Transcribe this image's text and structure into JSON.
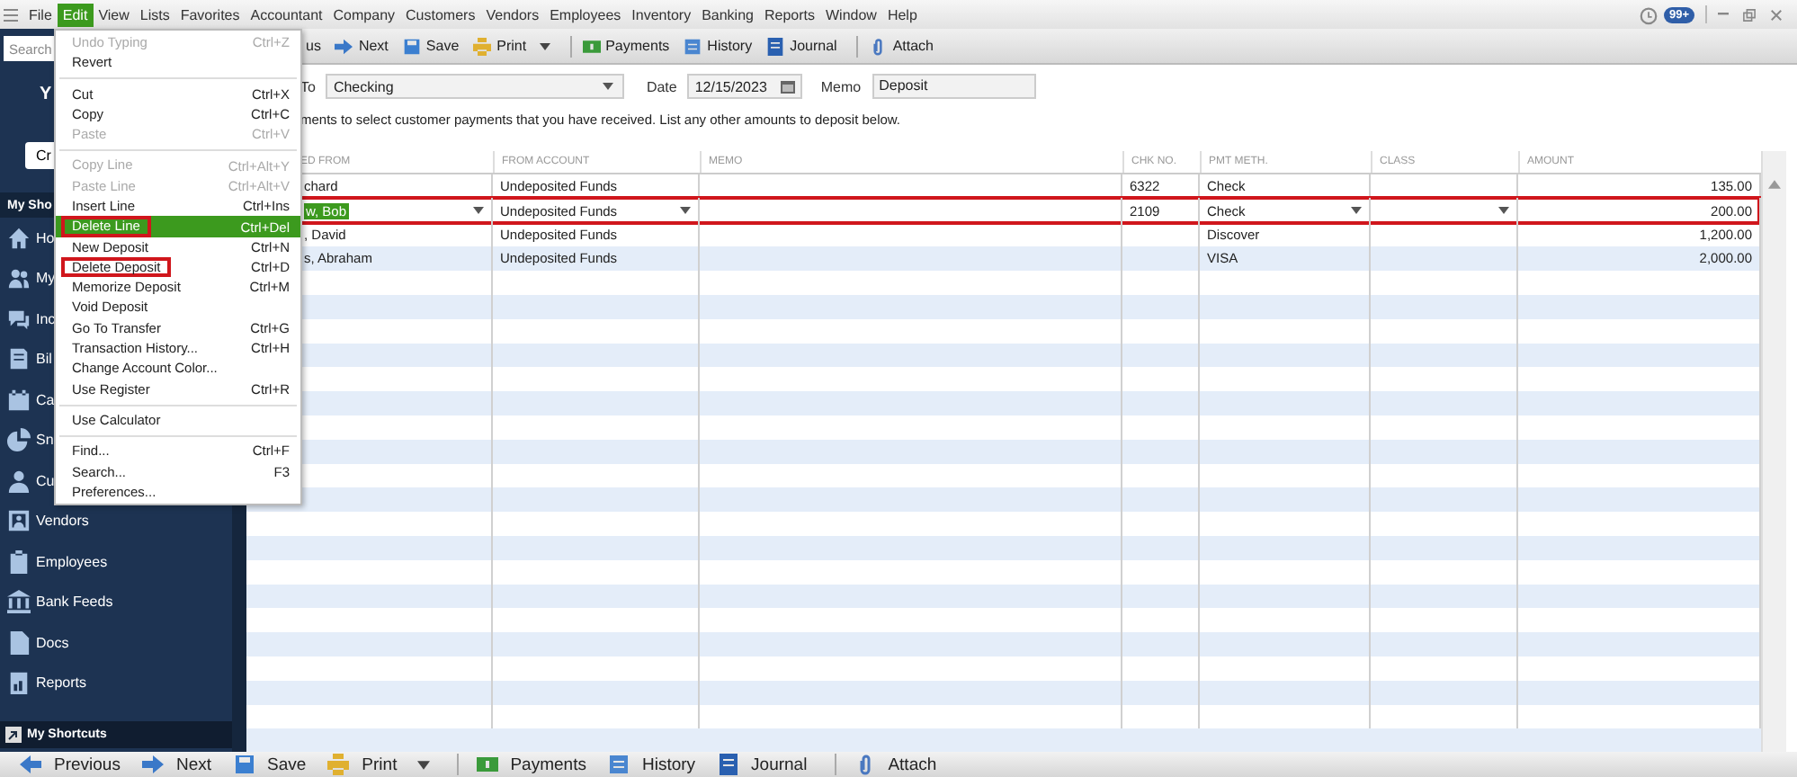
{
  "menu_bar": [
    {
      "label": "File",
      "selected": false
    },
    {
      "label": "Edit",
      "selected": true
    },
    {
      "label": "View",
      "selected": false
    },
    {
      "label": "Lists",
      "selected": false
    },
    {
      "label": "Favorites",
      "selected": false
    },
    {
      "label": "Accountant",
      "selected": false
    },
    {
      "label": "Company",
      "selected": false
    },
    {
      "label": "Customers",
      "selected": false
    },
    {
      "label": "Vendors",
      "selected": false
    },
    {
      "label": "Employees",
      "selected": false
    },
    {
      "label": "Inventory",
      "selected": false
    },
    {
      "label": "Banking",
      "selected": false
    },
    {
      "label": "Reports",
      "selected": false
    },
    {
      "label": "Window",
      "selected": false
    },
    {
      "label": "Help",
      "selected": false
    }
  ],
  "notification_badge": "99+",
  "sidebar": {
    "search_placeholder": "Search",
    "company_label": "Y",
    "create_button": "Cr",
    "section_title": "My Sho",
    "items": [
      "Ho",
      "My",
      "Inc",
      "Bil",
      "Ca",
      "Sn",
      "Cu",
      "Vendors",
      "Employees",
      "Bank Feeds",
      "Docs",
      "Reports"
    ],
    "footer": "My Shortcuts"
  },
  "toolbar": [
    {
      "label": "us",
      "dropdown": false,
      "separator_before": false
    },
    {
      "label": "Next",
      "dropdown": false,
      "separator_before": false
    },
    {
      "label": "Save",
      "dropdown": false,
      "separator_before": false
    },
    {
      "label": "Print",
      "dropdown": true,
      "separator_before": false
    },
    {
      "label": "Payments",
      "dropdown": false,
      "separator_before": true
    },
    {
      "label": "History",
      "dropdown": false,
      "separator_before": false
    },
    {
      "label": "Journal",
      "dropdown": false,
      "separator_before": false
    },
    {
      "label": "Attach",
      "dropdown": false,
      "separator_before": true
    }
  ],
  "edit_menu": [
    {
      "kind": "item",
      "label": "Undo Typing",
      "shortcut": "Ctrl+Z",
      "disabled": true,
      "highlighted": false,
      "outlined": false
    },
    {
      "kind": "item",
      "label": "Revert",
      "disabled": false,
      "highlighted": false,
      "outlined": false
    },
    {
      "kind": "separator"
    },
    {
      "kind": "item",
      "label": "Cut",
      "shortcut": "Ctrl+X",
      "disabled": false,
      "highlighted": false,
      "outlined": false
    },
    {
      "kind": "item",
      "label": "Copy",
      "shortcut": "Ctrl+C",
      "disabled": false,
      "highlighted": false,
      "outlined": false
    },
    {
      "kind": "item",
      "label": "Paste",
      "shortcut": "Ctrl+V",
      "disabled": true,
      "highlighted": false,
      "outlined": false
    },
    {
      "kind": "separator"
    },
    {
      "kind": "item",
      "label": "Copy Line",
      "shortcut": "Ctrl+Alt+Y",
      "disabled": true,
      "highlighted": false,
      "outlined": false
    },
    {
      "kind": "item",
      "label": "Paste Line",
      "shortcut": "Ctrl+Alt+V",
      "disabled": true,
      "highlighted": false,
      "outlined": false
    },
    {
      "kind": "item",
      "label": "Insert Line",
      "shortcut": "Ctrl+Ins",
      "disabled": false,
      "highlighted": false,
      "outlined": false
    },
    {
      "kind": "item",
      "label": "Delete Line",
      "shortcut": "Ctrl+Del",
      "disabled": false,
      "highlighted": true,
      "outlined": true
    },
    {
      "kind": "item",
      "label": "New Deposit",
      "shortcut": "Ctrl+N",
      "disabled": false,
      "highlighted": false,
      "outlined": false
    },
    {
      "kind": "item",
      "label": "Delete Deposit",
      "shortcut": "Ctrl+D",
      "disabled": false,
      "highlighted": false,
      "outlined": true
    },
    {
      "kind": "item",
      "label": "Memorize Deposit",
      "shortcut": "Ctrl+M",
      "disabled": false,
      "highlighted": false,
      "outlined": false
    },
    {
      "kind": "item",
      "label": "Void Deposit",
      "disabled": false,
      "highlighted": false,
      "outlined": false
    },
    {
      "kind": "item",
      "label": "Go To Transfer",
      "shortcut": "Ctrl+G",
      "disabled": false,
      "highlighted": false,
      "outlined": false
    },
    {
      "kind": "item",
      "label": "Transaction History...",
      "shortcut": "Ctrl+H",
      "disabled": false,
      "highlighted": false,
      "outlined": false
    },
    {
      "kind": "item",
      "label": "Change Account Color...",
      "disabled": false,
      "highlighted": false,
      "outlined": false
    },
    {
      "kind": "item",
      "label": "Use Register",
      "shortcut": "Ctrl+R",
      "disabled": false,
      "highlighted": false,
      "outlined": false
    },
    {
      "kind": "separator"
    },
    {
      "kind": "item",
      "label": "Use Calculator",
      "disabled": false,
      "highlighted": false,
      "outlined": false
    },
    {
      "kind": "separator"
    },
    {
      "kind": "item",
      "label": "Find...",
      "shortcut": "Ctrl+F",
      "disabled": false,
      "highlighted": false,
      "outlined": false
    },
    {
      "kind": "item",
      "label": "Search...",
      "shortcut": "F3",
      "disabled": false,
      "highlighted": false,
      "outlined": false
    },
    {
      "kind": "item",
      "label": "Preferences...",
      "disabled": false,
      "highlighted": false,
      "outlined": false
    }
  ],
  "form": {
    "to_label": "To",
    "account": "Checking",
    "date_label": "Date",
    "date": "12/15/2023",
    "memo_label": "Memo",
    "memo": "Deposit",
    "instructions": "ments to select customer payments that you have received. List any other amounts to deposit below."
  },
  "table": {
    "columns": [
      "ED FROM",
      "FROM ACCOUNT",
      "MEMO",
      "CHK NO.",
      "PMT METH.",
      "CLASS",
      "AMOUNT"
    ],
    "rows": [
      {
        "cells": [
          "chard",
          "Undeposited Funds",
          "",
          "6322",
          "Check",
          "",
          "135.00"
        ],
        "selected": false,
        "outlined": false
      },
      {
        "cells": [
          "w, Bob",
          "Undeposited Funds",
          "",
          "2109",
          "Check",
          "",
          "200.00"
        ],
        "selected": true,
        "outlined": true
      },
      {
        "cells": [
          ", David",
          "Undeposited Funds",
          "",
          "",
          "Discover",
          "",
          "1,200.00"
        ],
        "selected": false,
        "outlined": false
      },
      {
        "cells": [
          "s, Abraham",
          "Undeposited Funds",
          "",
          "",
          "VISA",
          "",
          "2,000.00"
        ],
        "selected": false,
        "outlined": false
      }
    ]
  },
  "bottom_toolbar": [
    {
      "label": "Previous",
      "dropdown": false,
      "separator_before": false
    },
    {
      "label": "Next",
      "dropdown": false,
      "separator_before": false
    },
    {
      "label": "Save",
      "dropdown": false,
      "separator_before": false
    },
    {
      "label": "Print",
      "dropdown": true,
      "separator_before": false
    },
    {
      "label": "Payments",
      "dropdown": false,
      "separator_before": true
    },
    {
      "label": "History",
      "dropdown": false,
      "separator_before": false
    },
    {
      "label": "Journal",
      "dropdown": false,
      "separator_before": false
    },
    {
      "label": "Attach",
      "dropdown": false,
      "separator_before": true
    }
  ]
}
